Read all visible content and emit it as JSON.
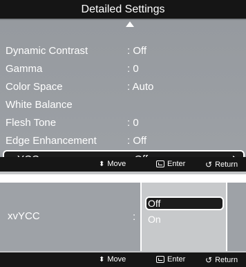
{
  "title": "Detailed Settings",
  "rows": [
    {
      "label": "Dynamic Contrast",
      "value": ": Off"
    },
    {
      "label": "Gamma",
      "value": ": 0"
    },
    {
      "label": "Color Space",
      "value": ": Auto"
    },
    {
      "label": "White Balance",
      "value": ""
    },
    {
      "label": "Flesh Tone",
      "value": ": 0"
    },
    {
      "label": "Edge Enhancement",
      "value": ": Off"
    },
    {
      "label": "xvYCC",
      "value": ": Off"
    }
  ],
  "footer": {
    "move": "Move",
    "enter": "Enter",
    "return": "Return"
  },
  "submenu": {
    "label": "xvYCC",
    "colon": ":",
    "options": [
      "Off",
      "On"
    ],
    "selected": "Off"
  },
  "colors": {
    "highlight": "#1c1c1c",
    "panel": "#9ea2a7"
  },
  "icons": [
    "up-arrow-icon",
    "right-arrow-icon",
    "move-icon",
    "enter-icon",
    "return-icon"
  ]
}
